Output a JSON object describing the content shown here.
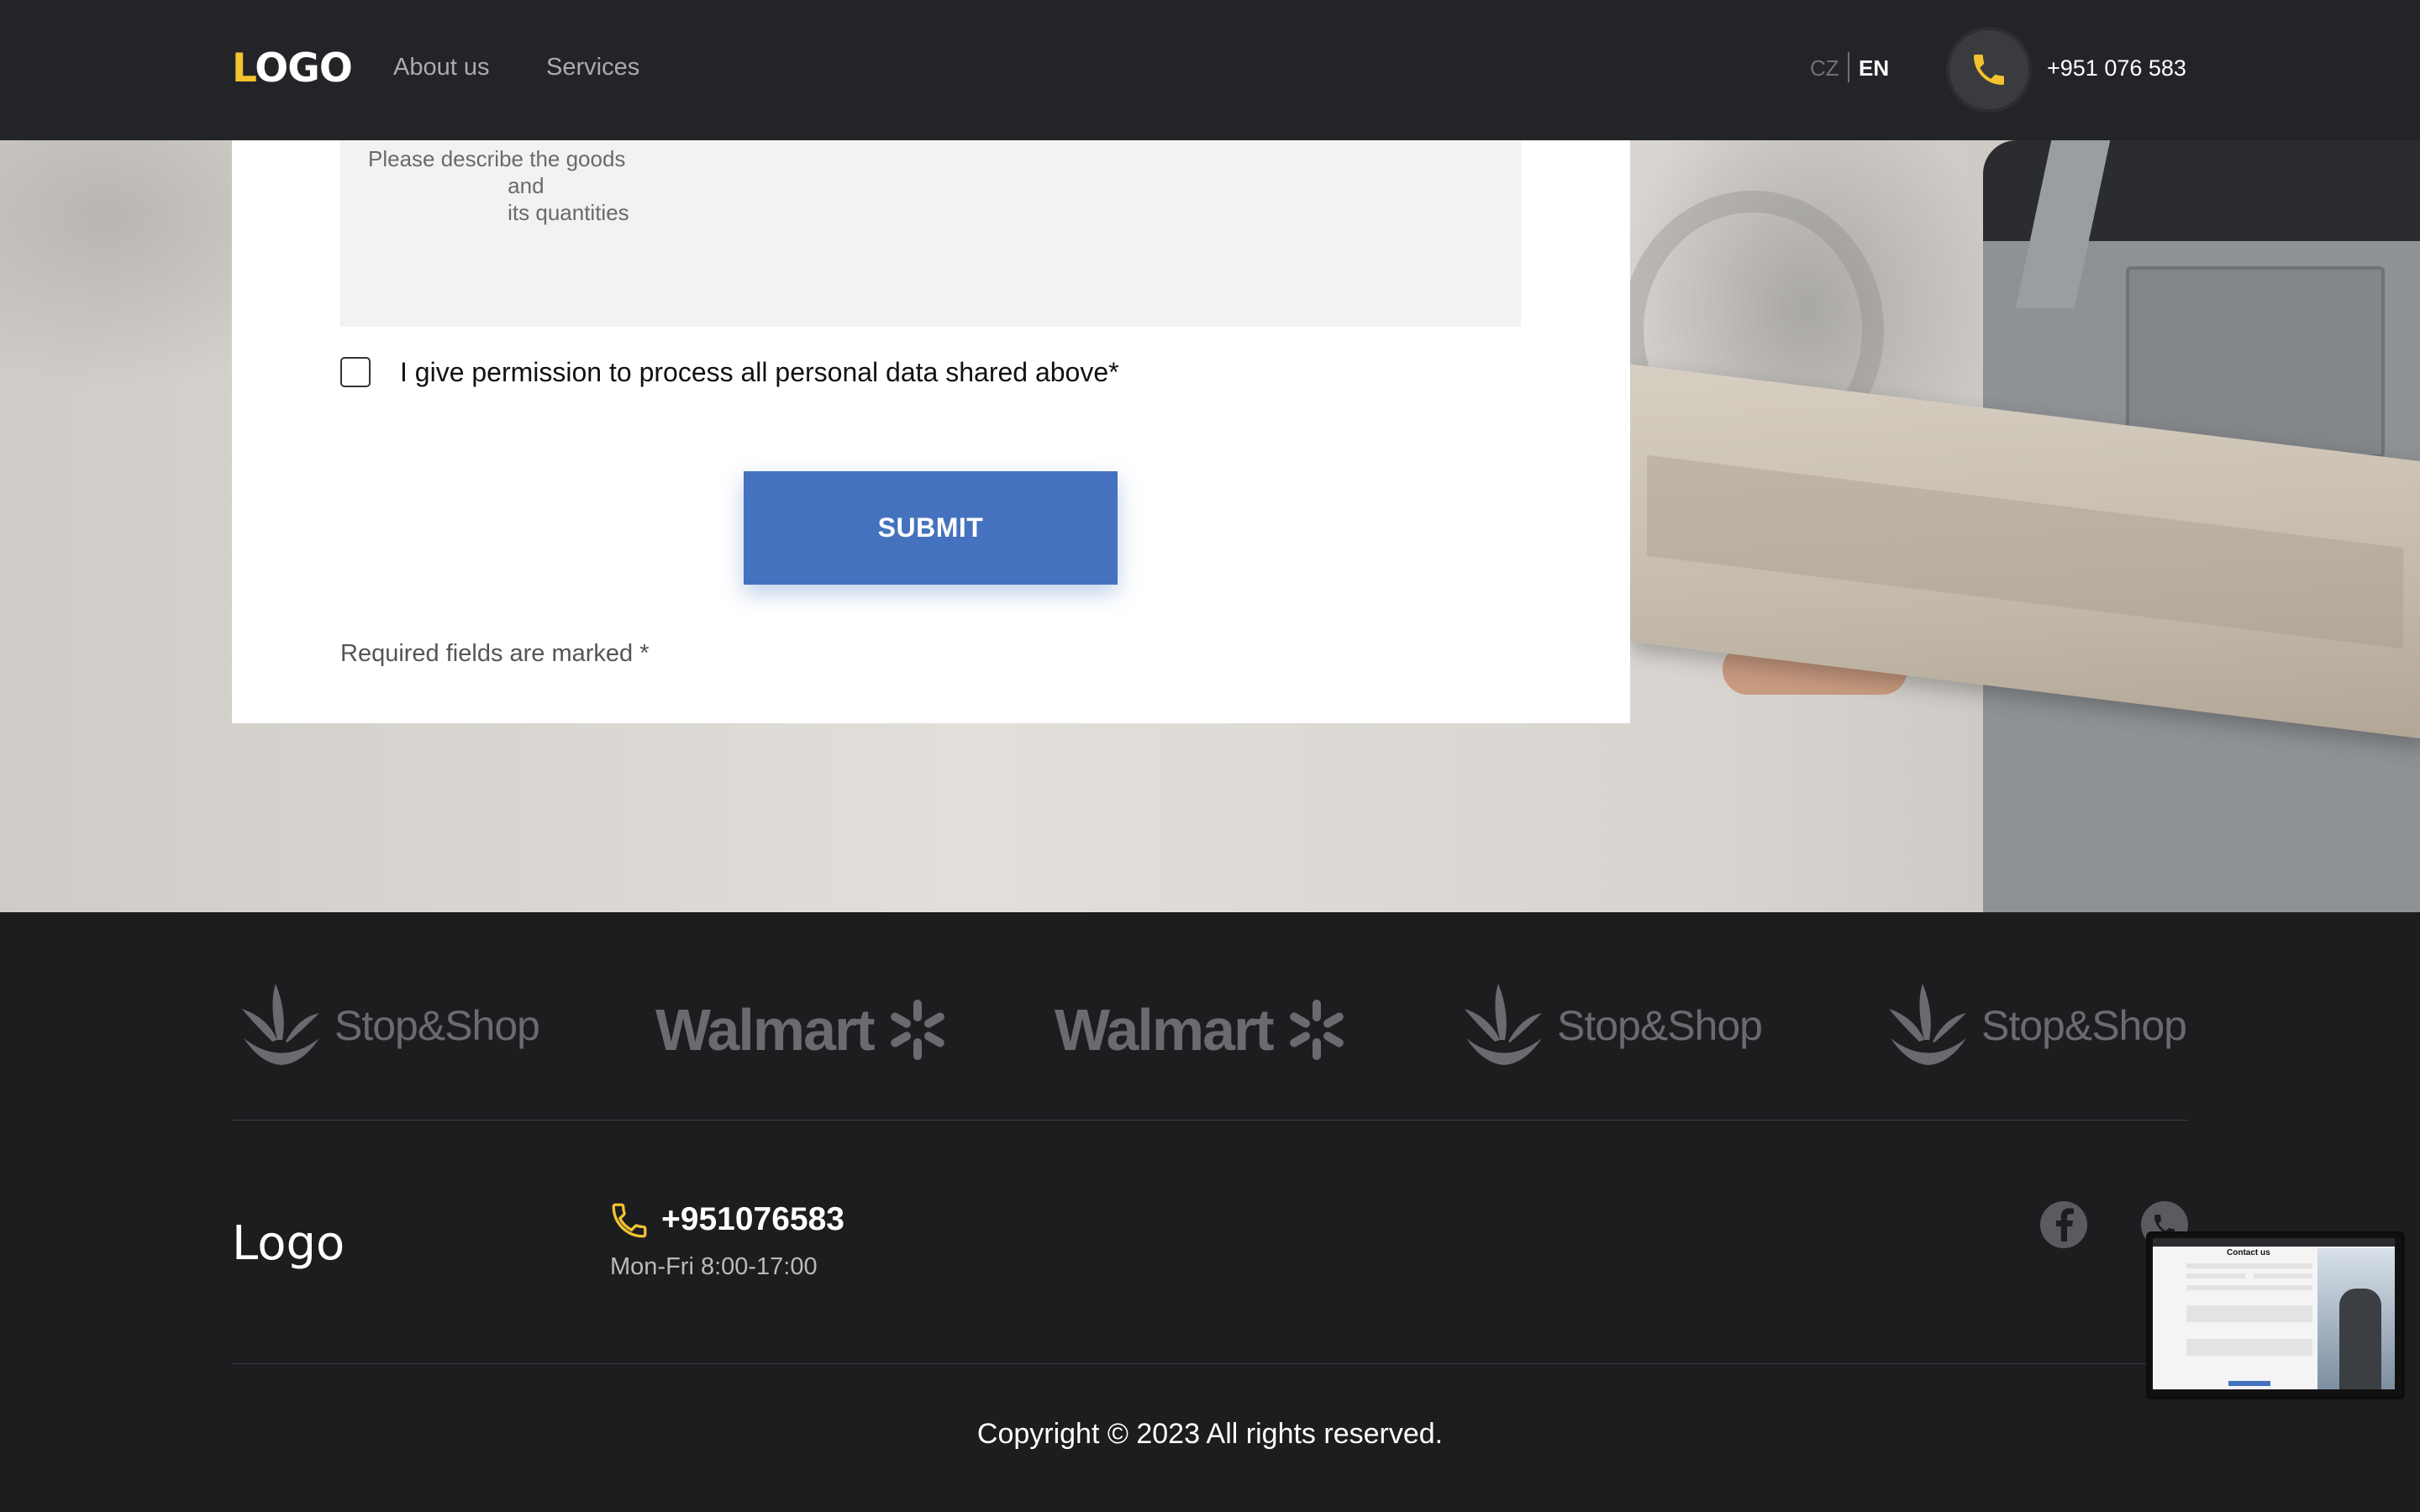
{
  "header": {
    "logo_first": "L",
    "logo_rest": "OGO",
    "nav": [
      "About us",
      "Services"
    ],
    "lang_cz": "CZ",
    "lang_en": "EN",
    "phone": "+951 076 583",
    "phone_icon": "phone-icon"
  },
  "form": {
    "textarea_placeholder": "Please describe the goods\n                       and\n                       its quantities",
    "checkbox_label": "I give permission to process all personal data shared above*",
    "submit_label": "SUBMIT",
    "required_note": "Required fields are marked *"
  },
  "brands": [
    "Stop&Shop",
    "Walmart",
    "Walmart",
    "Stop&Shop",
    "Stop&Shop"
  ],
  "footer": {
    "logo": "Logo",
    "phone": "+951076583",
    "hours": "Mon-Fri 8:00-17:00",
    "social": [
      "facebook-icon",
      "phone-icon"
    ],
    "copyright": "Copyright © 2023 All rights reserved."
  },
  "thumbnail": {
    "title": "Contact us"
  },
  "colors": {
    "accent": "#f2c230",
    "submit": "#4472be",
    "header_bg": "#232427",
    "footer_bg": "#1c1d1f"
  }
}
